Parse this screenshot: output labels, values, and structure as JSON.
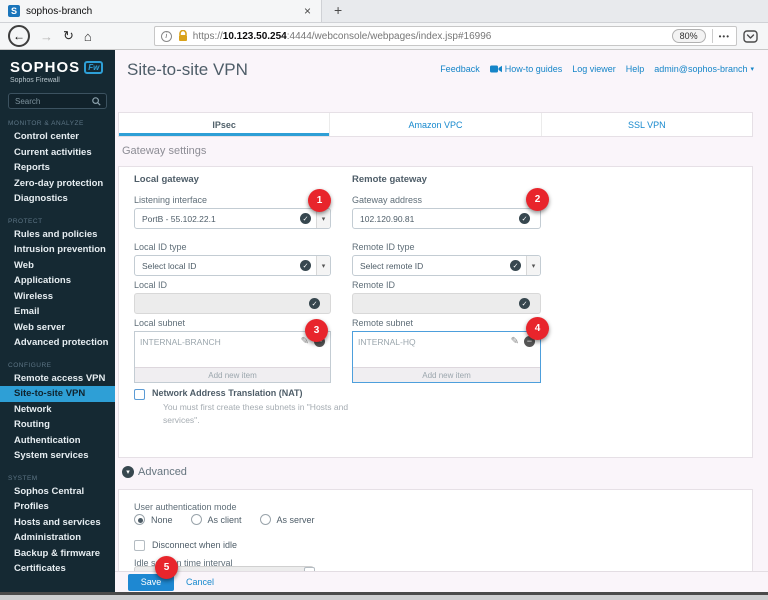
{
  "colors": {
    "accent_blue": "#2e9fd6",
    "link_blue": "#1585c8",
    "sidebar_bg": "#152933",
    "badge_red": "#e8252c",
    "save_blue": "#1e88d2"
  },
  "icons": {
    "back": "←",
    "forward": "→",
    "reload": "↻",
    "home": "⌂",
    "close": "×",
    "new_tab": "+",
    "caret": "▾",
    "check": "✓",
    "pencil": "✎",
    "minus": "−",
    "dots": "•••",
    "info": "i",
    "favicon_letter": "S"
  },
  "browser": {
    "tab_title": "sophos-branch",
    "url_prefix": "https://",
    "url_host": "10.123.50.254",
    "url_rest": ":4444/webconsole/webpages/index.jsp#16996",
    "zoom_level": "80%"
  },
  "sidebar": {
    "brand": "SOPHOS",
    "brand_badge": "Fw",
    "brand_sub": "Sophos Firewall",
    "search_placeholder": "Search",
    "sections": [
      {
        "label": "MONITOR & ANALYZE",
        "items": [
          "Control center",
          "Current activities",
          "Reports",
          "Zero-day protection",
          "Diagnostics"
        ]
      },
      {
        "label": "PROTECT",
        "items": [
          "Rules and policies",
          "Intrusion prevention",
          "Web",
          "Applications",
          "Wireless",
          "Email",
          "Web server",
          "Advanced protection"
        ]
      },
      {
        "label": "CONFIGURE",
        "items": [
          "Remote access VPN",
          "Site-to-site VPN",
          "Network",
          "Routing",
          "Authentication",
          "System services"
        ],
        "active_item": "Site-to-site VPN"
      },
      {
        "label": "SYSTEM",
        "items": [
          "Sophos Central",
          "Profiles",
          "Hosts and services",
          "Administration",
          "Backup & firmware",
          "Certificates"
        ]
      }
    ]
  },
  "header": {
    "title": "Site-to-site VPN",
    "feedback": "Feedback",
    "howto": "How-to guides",
    "logviewer": "Log viewer",
    "help": "Help",
    "admin": "admin@sophos-branch"
  },
  "tabs": [
    {
      "label": "IPsec",
      "active": true
    },
    {
      "label": "Amazon VPC",
      "active": false
    },
    {
      "label": "SSL VPN",
      "active": false
    }
  ],
  "form": {
    "section_title": "Gateway settings",
    "local": {
      "heading": "Local gateway",
      "listening_interface": {
        "label": "Listening interface",
        "value": "PortB - 55.102.22.1"
      },
      "id_type": {
        "label": "Local ID type",
        "value": "Select local ID"
      },
      "id": {
        "label": "Local ID",
        "value": ""
      },
      "subnet": {
        "label": "Local subnet",
        "item": "INTERNAL-BRANCH",
        "add_label": "Add new item"
      }
    },
    "remote": {
      "heading": "Remote gateway",
      "gateway_address": {
        "label": "Gateway address",
        "value": "102.120.90.81"
      },
      "id_type": {
        "label": "Remote ID type",
        "value": "Select remote ID"
      },
      "id": {
        "label": "Remote ID",
        "value": ""
      },
      "subnet": {
        "label": "Remote subnet",
        "item": "INTERNAL-HQ",
        "add_label": "Add new item"
      }
    },
    "nat": {
      "label": "Network Address Translation (NAT)",
      "hint": "You must first create these subnets in \"Hosts and services\"."
    },
    "advanced": {
      "heading": "Advanced",
      "auth_label": "User authentication mode",
      "auth_none": "None",
      "auth_client": "As client",
      "auth_server": "As server",
      "disconnect_label": "Disconnect when idle",
      "idle_label": "Idle session time interval"
    }
  },
  "footer": {
    "save": "Save",
    "cancel": "Cancel"
  },
  "badges": [
    "1",
    "2",
    "3",
    "4",
    "5"
  ]
}
